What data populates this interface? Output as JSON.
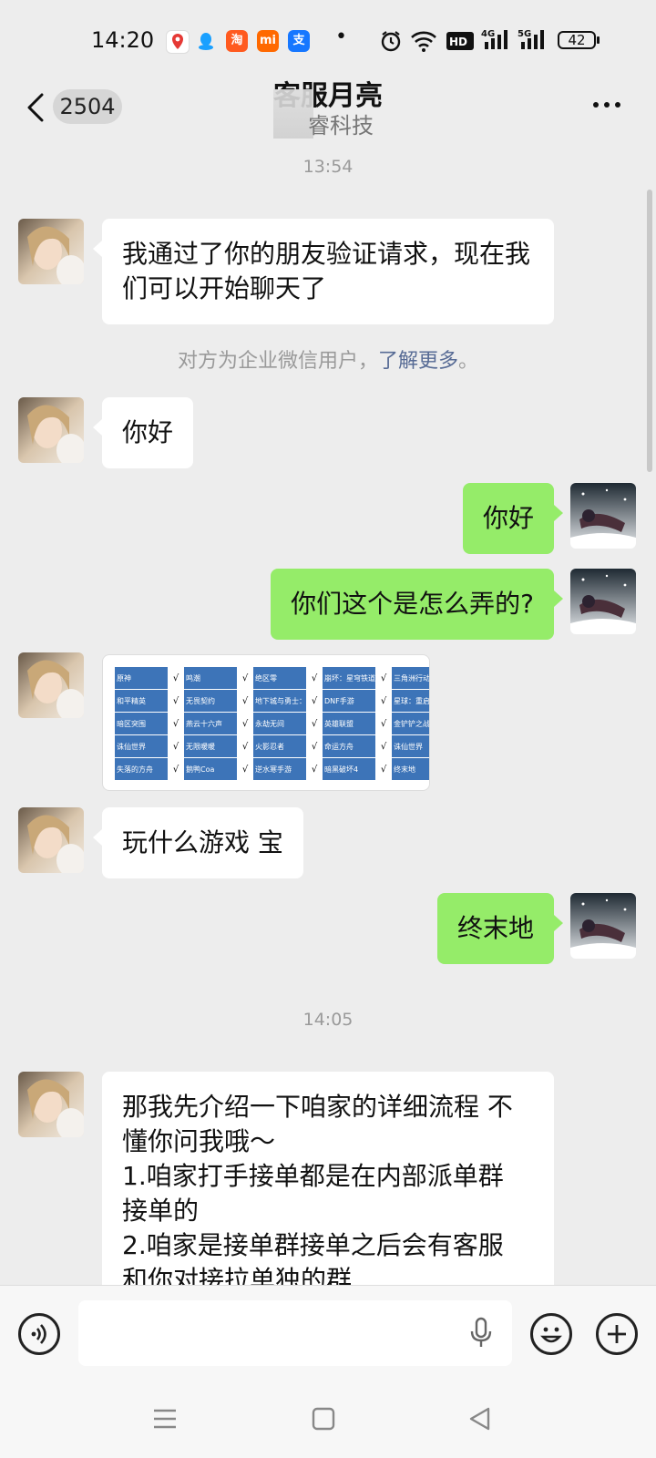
{
  "status_bar": {
    "time": "14:20",
    "battery": "42",
    "icons": [
      "maps-app-icon",
      "qq-app-icon",
      "taobao-app-icon",
      "mi-app-icon",
      "alipay-app-icon",
      "notification-dot",
      "alarm-icon",
      "wifi-icon",
      "hd-icon",
      "signal-4g-icon",
      "signal-5g-icon",
      "battery-icon"
    ]
  },
  "header": {
    "back_count": "2504",
    "title": "客服月亮",
    "subtitle": "睿科技"
  },
  "messages": [
    {
      "type": "time",
      "text": "13:54"
    },
    {
      "type": "in",
      "text": "我通过了你的朋友验证请求，现在我们可以开始聊天了"
    },
    {
      "type": "system",
      "text": "对方为企业微信用户，",
      "link": "了解更多",
      "suffix": "。"
    },
    {
      "type": "in",
      "text": "你好"
    },
    {
      "type": "out",
      "text": "你好"
    },
    {
      "type": "out",
      "text": "你们这个是怎么弄的?"
    },
    {
      "type": "image"
    },
    {
      "type": "in",
      "text": "玩什么游戏 宝"
    },
    {
      "type": "out",
      "text": "终末地"
    },
    {
      "type": "time",
      "text": "14:05"
    },
    {
      "type": "in",
      "lines": [
        "那我先介绍一下咱家的详细流程 不",
        "懂你问我哦～",
        "1.咱家打手接单都是在内部派单群",
        "接单的",
        "2.咱家是接单群接单之后会有客服",
        "和你对接拉单独的群"
      ]
    }
  ],
  "image_table": {
    "check": "√",
    "rows": [
      [
        "原神",
        "鸣潮",
        "绝区零",
        "崩坏：星穹铁道",
        "三角洲行动"
      ],
      [
        "和平精英",
        "无畏契约",
        "地下城与勇士：起源",
        "DNF手游",
        "星球：重启"
      ],
      [
        "暗区突围",
        "燕云十六声",
        "永劫无间",
        "英雄联盟",
        "金铲铲之战"
      ],
      [
        "诛仙世界",
        "无限暖暖",
        "火影忍者",
        "命运方舟",
        "诛仙世界"
      ],
      [
        "失落的方舟",
        "鹅鸭Coa",
        "逆水寒手游",
        "暗黑破坏4",
        "终末地"
      ]
    ]
  },
  "input_bar": {
    "placeholder": ""
  },
  "nav": {
    "icons": [
      "menu-icon",
      "home-icon",
      "back-triangle-icon"
    ]
  }
}
